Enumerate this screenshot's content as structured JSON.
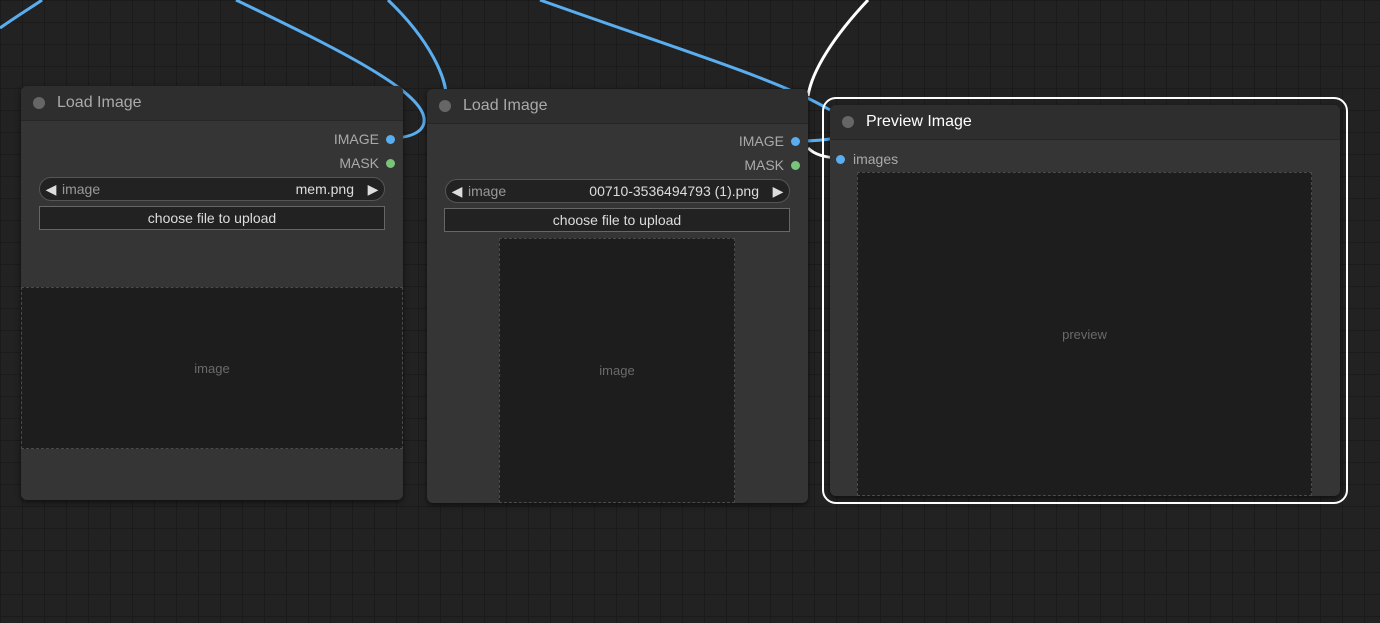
{
  "colors": {
    "image_link": "#5aaeef",
    "mask_link": "#7ac47a",
    "selected_outline": "#ffffff",
    "node_bg": "#353535",
    "canvas_bg": "#222222"
  },
  "nodes": {
    "load_image_1": {
      "title": "Load Image",
      "outputs": [
        "IMAGE",
        "MASK"
      ],
      "combo_label": "image",
      "combo_value": "mem.png",
      "upload_label": "choose file to upload"
    },
    "load_image_2": {
      "title": "Load Image",
      "outputs": [
        "IMAGE",
        "MASK"
      ],
      "combo_label": "image",
      "combo_value": "00710-3536494793 (1).png",
      "upload_label": "choose file to upload"
    },
    "preview_image": {
      "title": "Preview Image",
      "input": "images"
    }
  }
}
